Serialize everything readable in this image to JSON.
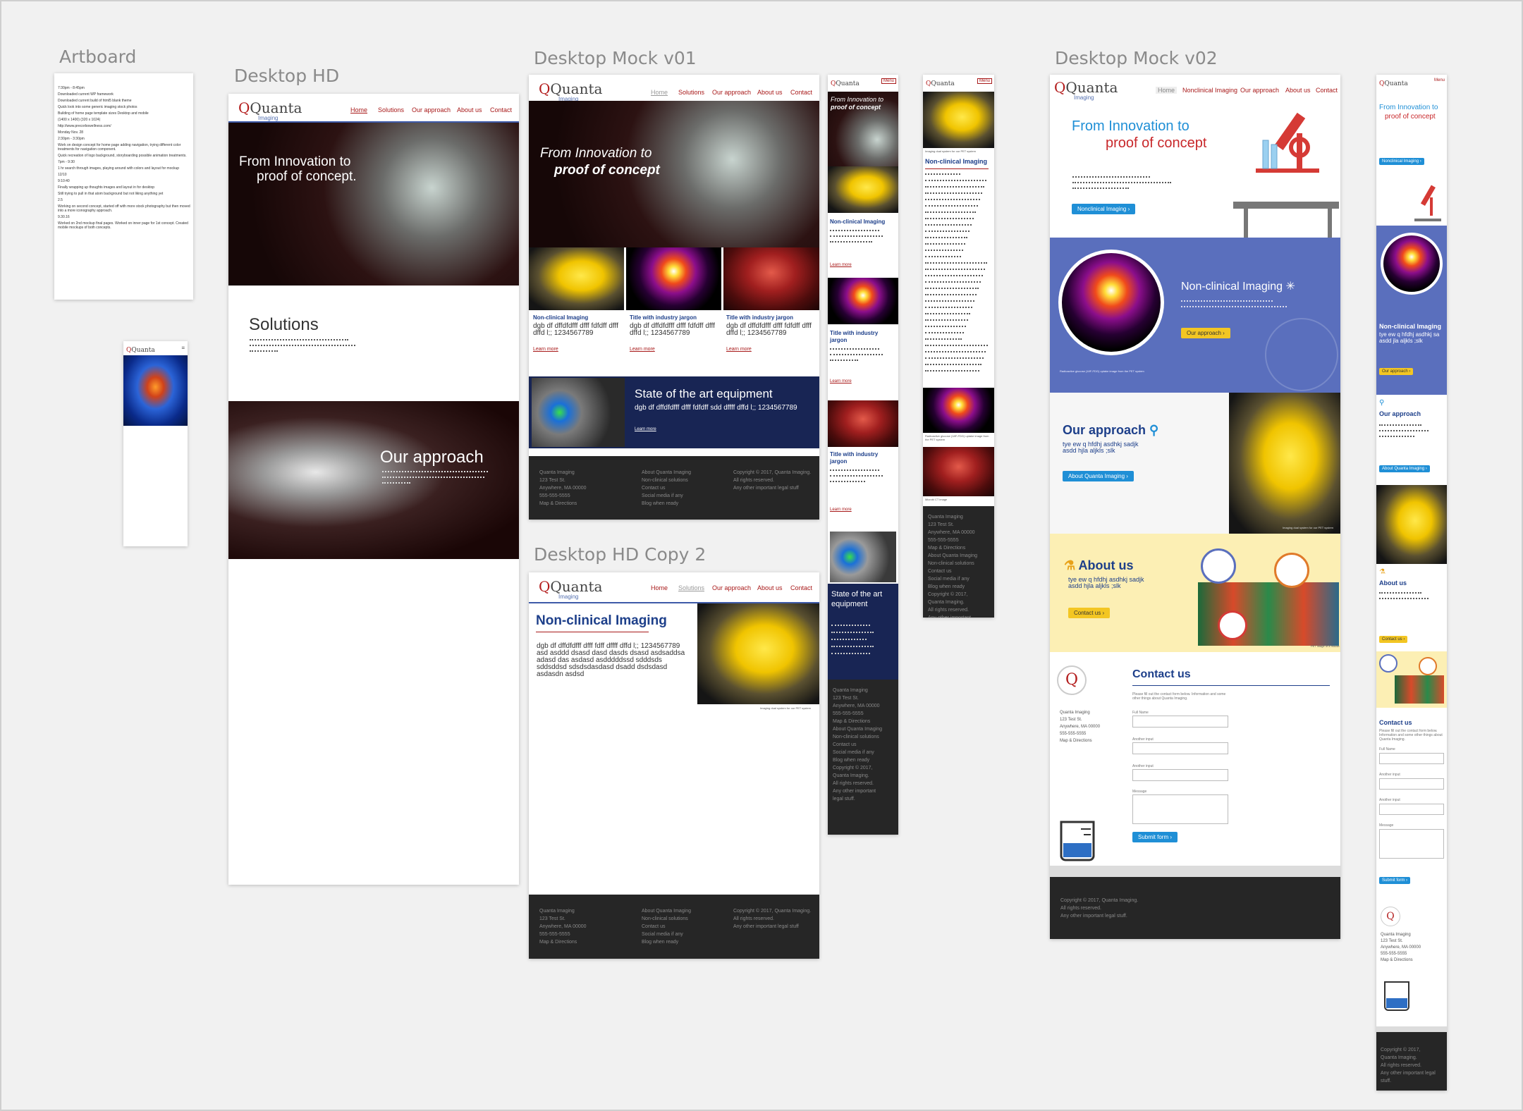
{
  "artboards": {
    "artboard": {
      "label": "Artboard",
      "notes": [
        "7:30pm - 8:45pm",
        "Downloaded current WP framework",
        "Downloaded current build of html5 blank theme",
        "Quick look into some generic imaging stock photos",
        "Building of home page template sizes Desktop and mobile",
        "(1400 x 1400) (320 x 1024)",
        "http://www.precorbowellness.com/",
        "Monday Nov. 28",
        "2:30pm - 3:30pm",
        "Work on design concept for home page adding navigation, trying different color treatments for navigation component.",
        "Quick recreation of logo background, storyboarding possible animation treatments.",
        "7pm - 9:30",
        "1 hr search through images, playing around with colors and layout for mockup",
        "12/10",
        "9:10:40",
        "Finally wrapping up thoughts images and layout in for desktop",
        "Still trying to pull in that atom background but not liking anything yet",
        "2.5",
        "Working on second concept, started off with more stock photography but then moved into a more iconography approach.",
        "9.30.16",
        "Worked on 2nd mockup final pages. Worked on inner page for 1st concept. Created mobile mockups of both concepts."
      ]
    },
    "desktop_hd": {
      "label": "Desktop HD",
      "nav": [
        "Home",
        "Solutions",
        "Our approach",
        "About us",
        "Contact"
      ],
      "hero_line1": "From Innovation to",
      "hero_line2": "proof of concept.",
      "solutions_title": "Solutions",
      "approach_title": "Our approach"
    },
    "mock_v01": {
      "label": "Desktop Mock v01",
      "nav": [
        "Home",
        "Solutions",
        "Our approach",
        "About us",
        "Contact"
      ],
      "hero_line1": "From Innovation to",
      "hero_line2": "proof of concept",
      "cards": [
        {
          "title": "Non-clinical Imaging",
          "body": "dgb df dffdfdfff dfff fdfdff dfff dffd l;; 1234567789",
          "link": "Learn more"
        },
        {
          "title": "Title with industry jargon",
          "body": "dgb df dffdfdfff dfff fdfdff dfff dffd l;; 1234567789",
          "link": "Learn more"
        },
        {
          "title": "Title with industry jargon",
          "body": "dgb df dffdfdfff dfff fdfdff dfff dffd l;; 1234567789",
          "link": "Learn more"
        }
      ],
      "state_title": "State of the art equipment",
      "state_body": "dgb df dffdfdfff dfff fdfdff sdd dffff dffd l;; 1234567789",
      "state_link": "Learn more",
      "footer": {
        "col1": [
          "Quanta Imaging",
          "123 Test St.",
          "Anywhere, MA 00000",
          "555-555-5555",
          "Map & Directions"
        ],
        "col2": [
          "About Quanta Imaging",
          "Non-clinical solutions",
          "Contact us",
          "Social media if any",
          "Blog when ready"
        ],
        "col3": [
          "Copyright © 2017, Quanta Imaging.",
          "All rights reserved.",
          "Any other important legal stuff"
        ]
      }
    },
    "hd_copy2": {
      "label": "Desktop HD Copy 2",
      "nav": [
        "Home",
        "Solutions",
        "Our approach",
        "About us",
        "Contact"
      ],
      "title": "Non-clinical Imaging",
      "body": "dgb df dffdfdfff dfff fdff dffff dffd l;; 1234567789 asd asddd dsasd dasd dasds dsasd asdsaddsa adasd das asdasd asdddddssd sdddsds sddsddsd sdsdsdasdasd dsadd dsdsdasd asdasdn asdsd",
      "caption": "Imaging dual system for our PET system"
    },
    "mobile_v01": {
      "menu": "Menu",
      "hero_line1": "From Innovation to",
      "hero_line2": "proof of concept",
      "card1_title": "Non-clinical Imaging",
      "card2_title": "Title with industry jargon",
      "card3_title": "Title with industry jargon",
      "link": "Learn more",
      "state_title": "State of the art equipment",
      "footer": [
        "Quanta Imaging",
        "123 Test St.",
        "Anywhere, MA 00000",
        "555-555-5555",
        "Map & Directions",
        "About Quanta Imaging",
        "Non-clinical solutions",
        "Contact us",
        "Social media if any",
        "Blog when ready",
        "Copyright © 2017,",
        "Quanta Imaging.",
        "All rights reserved.",
        "Any other important",
        "legal stuff."
      ]
    },
    "mobile_v01b": {
      "menu": "Menu",
      "caption1": "Imaging dual system for our PET system",
      "title": "Non-clinical Imaging",
      "caption2": "Radioactive glucose (18F-FDG) uptake image from the PET system",
      "caption3": "Microbl CT image"
    },
    "mock_v02": {
      "label": "Desktop Mock v02",
      "nav": [
        "Home",
        "Nonclinical Imaging",
        "Our approach",
        "About us",
        "Contact"
      ],
      "hero_line1": "From Innovation to",
      "hero_line2": "proof of concept",
      "hero_button": "Nonclinical Imaging",
      "nc_title": "Non-clinical Imaging",
      "nc_button": "Our approach",
      "nc_caption": "Radioactive glucose (18F-FDG) uptake image from the PET system",
      "approach_title": "Our approach",
      "approach_body": "tye ew q hfdhj asdhkj sadjk asdd hjla aljkls ;slk",
      "approach_button": "About Quanta Imaging",
      "approach_caption": "Imaging dual system for our PET system",
      "about_title": "About us",
      "about_body": "tye ew q hfdhj asdhkj sadjk asdd hjla aljkls ;slk",
      "about_button": "Contact us",
      "about_caption": "PET image of a mouse",
      "contact_title": "Contact us",
      "contact_intro": "Please fill out the contact form below. Information and some other things about Quanta Imaging.",
      "address": [
        "Quanta Imaging",
        "123 Test St.",
        "Anywhere, MA 00000",
        "555-555-5555",
        "Map & Directions"
      ],
      "fields": [
        "Full Name",
        "Another input",
        "Another input",
        "Message"
      ],
      "submit": "Submit form",
      "footer": [
        "Copyright © 2017, Quanta Imaging.",
        "All rights reserved.",
        "Any other important legal stuff."
      ]
    },
    "mobile_v02": {
      "menu": "Menu",
      "hero_line1": "From Innovation to",
      "hero_line2": "proof of concept",
      "hero_button": "Nonclinical Imaging",
      "nc_title": "Non-clinical Imaging",
      "nc_body": "tye ew q hfdhj asdhkj sa asdd jla aljkls ;slk",
      "nc_button": "Our approach",
      "approach_title": "Our approach",
      "approach_button": "About Quanta Imaging",
      "about_title": "About us",
      "about_button": "Contact us",
      "contact_title": "Contact us",
      "contact_intro": "Please fill out the contact form below. Information and some other things about Quanta Imaging.",
      "fields": [
        "Full Name",
        "Another input",
        "Another input",
        "Message"
      ],
      "submit": "Submit form",
      "address": [
        "Quanta Imaging",
        "123 Test St.",
        "Anywhere, MA 00000",
        "555-555-5555",
        "Map & Directions"
      ],
      "footer": [
        "Copyright © 2017,",
        "Quanta Imaging.",
        "All rights reserved.",
        "Any other important legal stuff."
      ]
    },
    "logo": {
      "name": "Quanta",
      "sub": "Imaging"
    },
    "colors": {
      "brand_red": "#b31d1d",
      "navy": "#1d2a55",
      "blue_section": "#5a6fbd",
      "yellow_section": "#fcefb4",
      "button_blue": "#1f8fd6",
      "button_yellow": "#f3c623",
      "footer": "#262626"
    }
  }
}
